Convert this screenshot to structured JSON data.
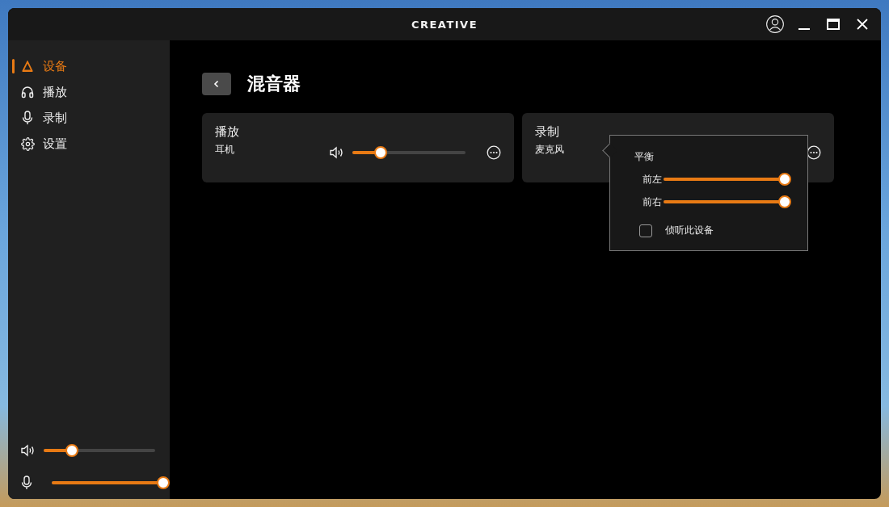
{
  "window": {
    "logo": "CREATIVE"
  },
  "sidebar": {
    "items": [
      {
        "label": "设备",
        "kind": "device",
        "selected": true
      },
      {
        "label": "播放",
        "kind": "headphones",
        "selected": false
      },
      {
        "label": "录制",
        "kind": "mic",
        "selected": false
      },
      {
        "label": "设置",
        "kind": "gear",
        "selected": false
      }
    ],
    "volume": {
      "level": 0.25
    },
    "mic": {
      "level": 1
    }
  },
  "page": {
    "title": "混音器"
  },
  "cards": [
    {
      "kind": "playback",
      "title": "播放",
      "device": "耳机",
      "level": 0.25
    },
    {
      "kind": "recording",
      "title": "录制",
      "device": "麦克风"
    }
  ],
  "popup": {
    "heading": "平衡",
    "channels": [
      {
        "label": "前左",
        "level": 1
      },
      {
        "label": "前右",
        "level": 1
      }
    ],
    "monitor": {
      "label": "侦听此设备",
      "checked": false
    }
  }
}
